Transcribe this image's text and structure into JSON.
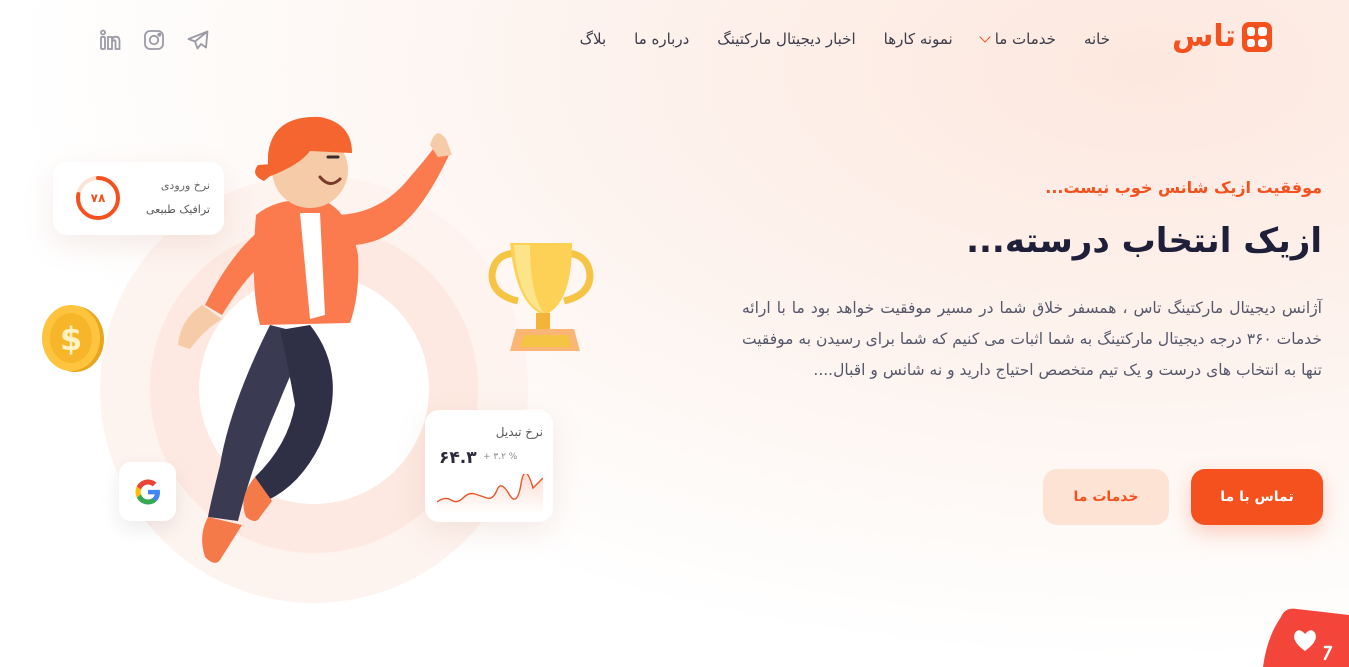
{
  "header": {
    "logo_text": "تاس",
    "nav": [
      {
        "label": "خانه",
        "dropdown": false
      },
      {
        "label": "خدمات ما",
        "dropdown": true
      },
      {
        "label": "نمونه کارها",
        "dropdown": false
      },
      {
        "label": "اخبار دیجیتال مارکتینگ",
        "dropdown": false
      },
      {
        "label": "درباره ما",
        "dropdown": false
      },
      {
        "label": "بلاگ",
        "dropdown": false
      }
    ],
    "socials": [
      "linkedin-icon",
      "instagram-icon",
      "telegram-icon"
    ]
  },
  "hero": {
    "tagline": "موفقیت ازیک شانس خوب نیست...",
    "headline": "ازیک انتخاب درسته...",
    "description": "آژانس دیجیتال مارکتینگ تاس ، همسفر خلاق شما در مسیر موفقیت خواهد بود ما با ارائه خدمات ۳۶۰ درجه دیجیتال مارکتینگ به شما اثبات می کنیم که شما برای رسیدن به موفقیت تنها به انتخاب های درست و یک تیم متخصص احتیاج دارید و نه شانس و اقبال....",
    "primary_button": "تماس با ما",
    "secondary_button": "خدمات ما"
  },
  "cards": {
    "traffic": {
      "title": "نرخ ورودی",
      "subtitle": "ترافیک طبیعی",
      "value": "۷۸",
      "percent": 78
    },
    "conversion": {
      "title": "نرخ تبدیل",
      "value": "۶۴.۳",
      "delta": "+ ۳.۲ %"
    }
  },
  "colors": {
    "accent": "#f4511e",
    "accent_soft": "#fde3d4",
    "text_dark": "#1f1f3a"
  }
}
